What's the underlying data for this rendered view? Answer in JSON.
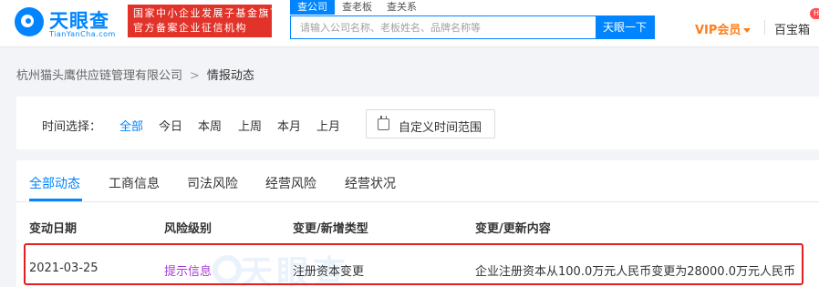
{
  "header": {
    "logo_name": "天眼查",
    "logo_url": "TianYanCha.com",
    "gov_line1": "国家中小企业发展子基金旗下",
    "gov_line2": "官方备案企业征信机构",
    "search_tabs": [
      {
        "label": "查公司",
        "active": true
      },
      {
        "label": "查老板",
        "active": false
      },
      {
        "label": "查关系",
        "active": false
      }
    ],
    "search_placeholder": "请输入公司名称、老板姓名、品牌名称等",
    "search_button": "天眼一下",
    "vip_label": "VIP会员",
    "treasure_label": "百宝箱",
    "hot_badge": "H"
  },
  "breadcrumb": {
    "company": "杭州猫头鹰供应链管理有限公司",
    "arrow": ">",
    "current": "情报动态"
  },
  "time_filter": {
    "label": "时间选择：",
    "options": [
      {
        "label": "全部",
        "active": true
      },
      {
        "label": "今日",
        "active": false
      },
      {
        "label": "本周",
        "active": false
      },
      {
        "label": "上周",
        "active": false
      },
      {
        "label": "本月",
        "active": false
      },
      {
        "label": "上月",
        "active": false
      }
    ],
    "custom_label": "自定义时间范围"
  },
  "tabs": [
    {
      "label": "全部动态",
      "active": true
    },
    {
      "label": "工商信息",
      "active": false
    },
    {
      "label": "司法风险",
      "active": false
    },
    {
      "label": "经营风险",
      "active": false
    },
    {
      "label": "经营状况",
      "active": false
    }
  ],
  "table": {
    "headers": [
      "变动日期",
      "风险级别",
      "变更/新增类型",
      "变更/更新内容"
    ],
    "rows": [
      [
        "2021-03-25",
        "提示信息",
        "注册资本变更",
        "企业注册资本从100.0万元人民币变更为28000.0万元人民币"
      ]
    ]
  },
  "colors": {
    "brand": "#0084ff",
    "gov_badge": "#e2332a",
    "vip": "#ff7d1a",
    "risk_hint": "#a53bd6",
    "highlight": "#e02020"
  }
}
